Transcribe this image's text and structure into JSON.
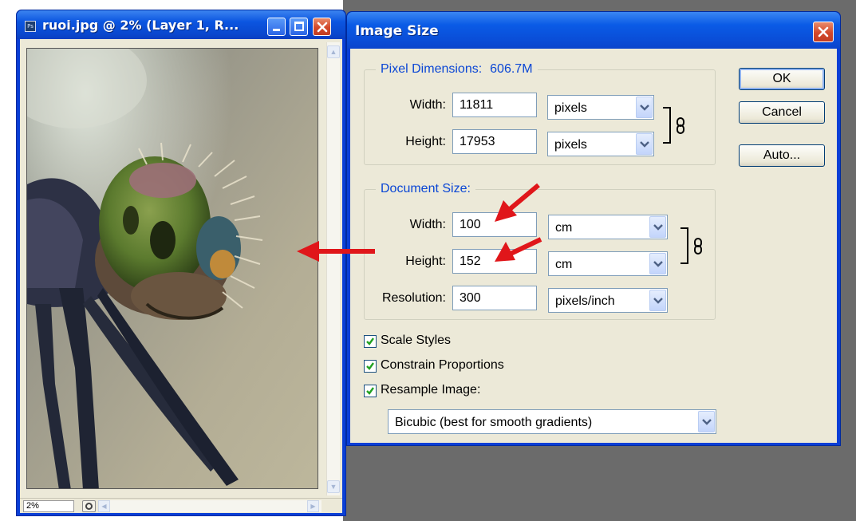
{
  "doc_window": {
    "app_badge": "Ps",
    "title": "ruoi.jpg @ 2% (Layer 1, R...",
    "zoom": "2%"
  },
  "dialog": {
    "title": "Image Size",
    "pixel_dimensions": {
      "legend": "Pixel Dimensions:",
      "total": "606.7M",
      "width_label": "Width:",
      "width_value": "11811",
      "width_unit": "pixels",
      "height_label": "Height:",
      "height_value": "17953",
      "height_unit": "pixels"
    },
    "document_size": {
      "legend": "Document Size:",
      "width_label": "Width:",
      "width_value": "100",
      "width_unit": "cm",
      "height_label": "Height:",
      "height_value": "152",
      "height_unit": "cm",
      "resolution_label": "Resolution:",
      "resolution_value": "300",
      "resolution_unit": "pixels/inch"
    },
    "buttons": {
      "ok": "OK",
      "cancel": "Cancel",
      "auto": "Auto..."
    },
    "checkboxes": [
      {
        "label": "Scale Styles",
        "checked": true
      },
      {
        "label": "Constrain Proportions",
        "checked": true
      },
      {
        "label": "Resample Image:",
        "checked": true
      }
    ],
    "resample_method": "Bicubic (best for smooth gradients)"
  },
  "colors": {
    "xp_title_blue": "#0a4ed8",
    "dialog_face": "#ece9d8",
    "legend_blue": "#0a46d5",
    "close_red": "#d3482a",
    "annotation_arrow": "#e0161a"
  }
}
